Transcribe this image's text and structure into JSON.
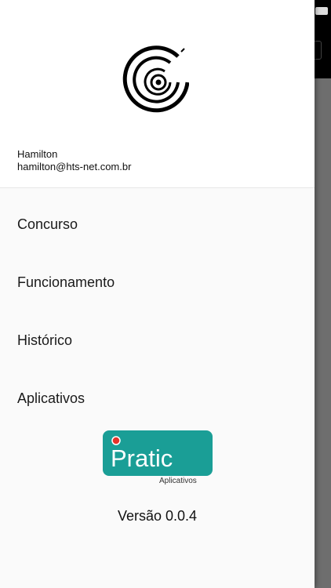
{
  "user": {
    "name": "Hamilton",
    "email": "hamilton@hts-net.com.br"
  },
  "menu": {
    "items": [
      {
        "label": "Concurso"
      },
      {
        "label": "Funcionamento"
      },
      {
        "label": "Histórico"
      },
      {
        "label": "Aplicativos"
      }
    ]
  },
  "brand": {
    "name": "Pratic",
    "tagline": "Aplicativos",
    "color": "#1a9e96",
    "dot_color": "#e5332a"
  },
  "footer": {
    "version": "Versão 0.0.4"
  },
  "icons": {
    "app_logo": "spiral-target-logo-icon"
  }
}
